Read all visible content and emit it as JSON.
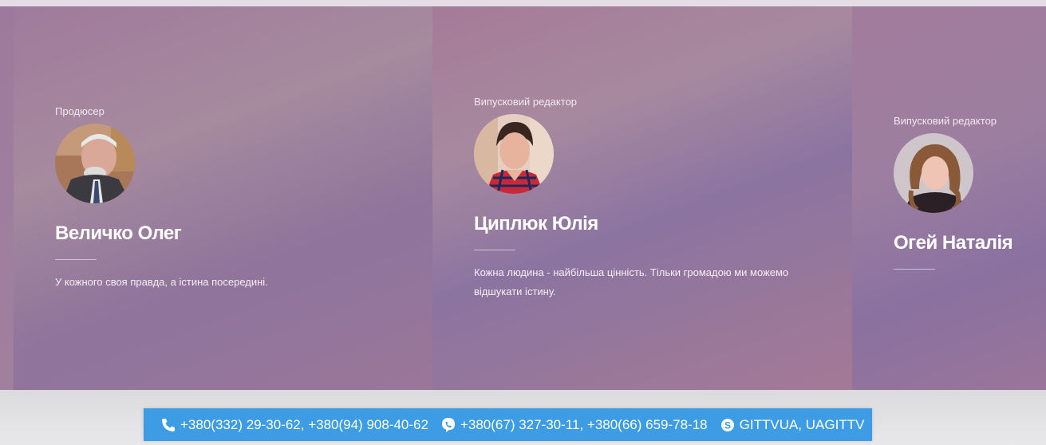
{
  "team": [
    {
      "role": "Продюсер",
      "name": "Величко Олег",
      "quote": "У кожного своя правда, а істина посередині."
    },
    {
      "role": "Випусковий редактор",
      "name": "Циплюк Юлія",
      "quote": "Кожна людина - найбільша цінність. Тільки громадою ми можемо відшукати істину."
    },
    {
      "role": "Випусковий редактор",
      "name": "Огей Наталія",
      "quote": ""
    }
  ],
  "contacts": {
    "phone_icon": "phone-icon",
    "phones": "+380(332) 29-30-62, +380(94) 908-40-62",
    "viber_icon": "viber-icon",
    "viber": "+380(67) 327-30-11, +380(66) 659-78-18",
    "skype_icon": "skype-icon",
    "skype": "GITTVUA, UAGITTV"
  },
  "colors": {
    "contact_bar": "#3d9ce3",
    "card_tint": "#9a7a9e"
  }
}
